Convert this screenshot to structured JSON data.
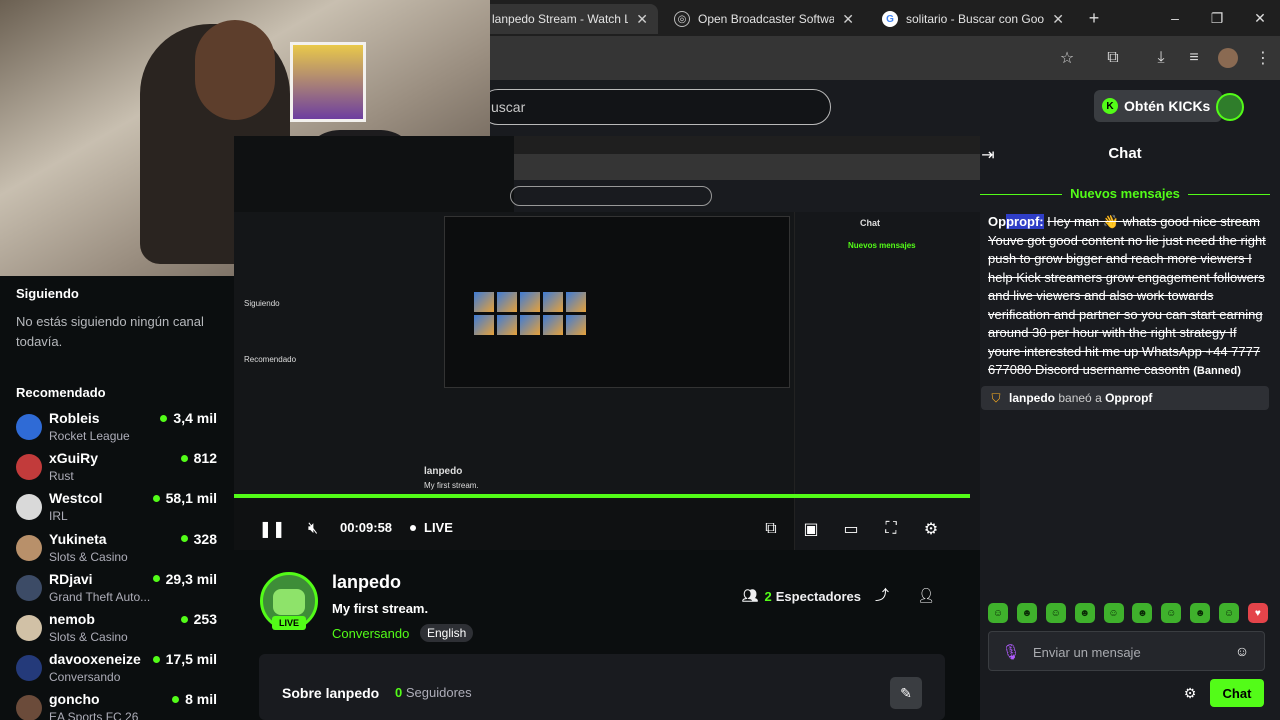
{
  "browser": {
    "tabs": [
      {
        "title": "lanpedo Stream - Watch Live on Kick",
        "icon": "kick-icon",
        "active": true
      },
      {
        "title": "Open Broadcaster Software | OBS",
        "icon": "obs-icon",
        "active": false
      },
      {
        "title": "solitario - Buscar con Google",
        "icon": "google-icon",
        "active": false
      }
    ],
    "new_tab": "+",
    "win_min": "–",
    "win_max": "❐",
    "win_close": "✕"
  },
  "header": {
    "search_placeholder": "uscar",
    "get_kicks": "Obtén KICKs"
  },
  "sidebar": {
    "following_title": "Siguiendo",
    "following_empty": "No estás siguiendo ningún canal todavía.",
    "recommended_title": "Recomendado",
    "channels": [
      {
        "name": "Robleis",
        "category": "Rocket League",
        "viewers": "3,4 mil",
        "color": "#2f6bd6"
      },
      {
        "name": "xGuiRy",
        "category": "Rust",
        "viewers": "812",
        "color": "#c23b3b"
      },
      {
        "name": "Westcol",
        "category": "IRL",
        "viewers": "58,1 mil",
        "color": "#d9d9d9"
      },
      {
        "name": "Yukineta",
        "category": "Slots & Casino",
        "viewers": "328",
        "color": "#b8906a"
      },
      {
        "name": "RDjavi",
        "category": "Grand Theft Auto...",
        "viewers": "29,3 mil",
        "color": "#3c4b66"
      },
      {
        "name": "nemob",
        "category": "Slots & Casino",
        "viewers": "253",
        "color": "#d1c1a6"
      },
      {
        "name": "davooxeneize",
        "category": "Conversando",
        "viewers": "17,5 mil",
        "color": "#243a7a"
      },
      {
        "name": "goncho",
        "category": "EA Sports FC 26",
        "viewers": "8 mil",
        "color": "#6b4b3a"
      }
    ]
  },
  "player": {
    "time": "00:09:58",
    "live": "LIVE"
  },
  "stream": {
    "name": "lanpedo",
    "title": "My first stream.",
    "category": "Conversando",
    "language": "English",
    "live_badge": "LIVE",
    "viewers_count": "2",
    "viewers_label": "Espectadores",
    "about_label": "Sobre lanpedo",
    "followers_count": "0",
    "followers_label": "Seguidores"
  },
  "chat": {
    "title": "Chat",
    "new_messages": "Nuevos mensajes",
    "message": {
      "user_prefix": "Op",
      "user_highlight": "propf:",
      "text": "Hey man 👋 whats good nice stream Youve got good content no lie just need the right push to grow bigger and reach more viewers I help Kick streamers grow engagement followers and live viewers and also work towards verification and partner so you can start earning around 30 per hour with the right strategy If youre interested hit me up WhatsApp +44 7777 677080 Discord username casontn",
      "status": "(Banned)"
    },
    "ban_notice": {
      "moderator": "lanpedo",
      "action": "baneó a",
      "target": "Oppropf"
    },
    "input_placeholder": "Enviar un mensaje",
    "send": "Chat"
  },
  "colors": {
    "accent": "#53fc18",
    "bg": "#0b0e0f",
    "panel": "#191b1f"
  }
}
